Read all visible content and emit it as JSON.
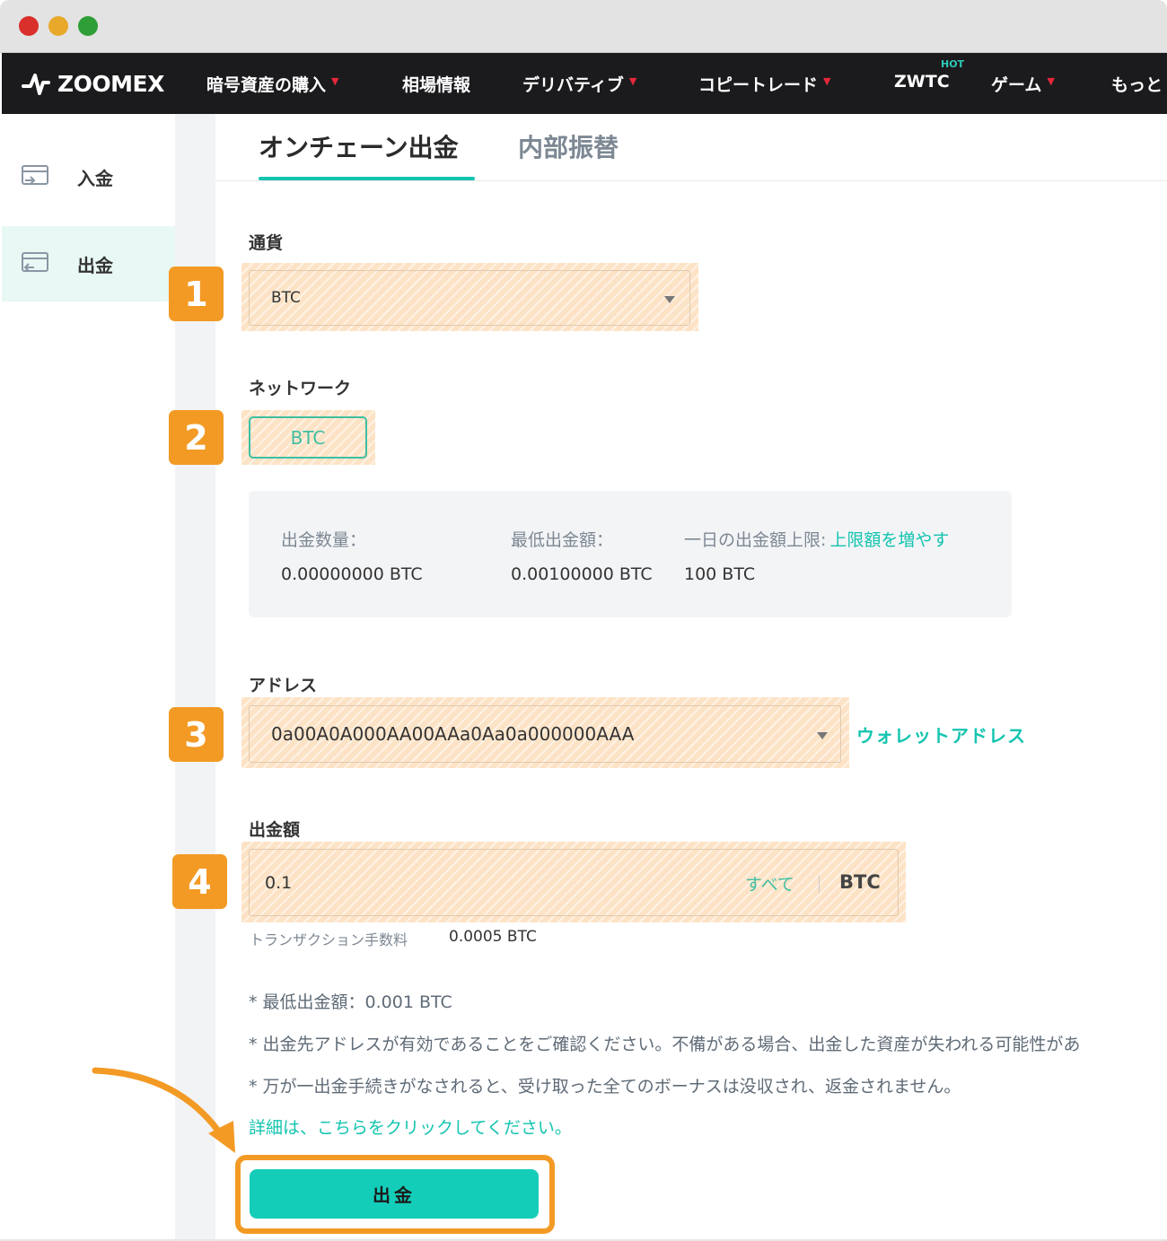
{
  "nav": {
    "brand": "ZOOMEX",
    "items": [
      {
        "label": "暗号資産の購入",
        "caret": "▼"
      },
      {
        "label": "相場情報",
        "caret": ""
      },
      {
        "label": "デリバティブ",
        "caret": "▼"
      },
      {
        "label": "コピートレード",
        "caret": "▼"
      },
      {
        "label": "ZWTC",
        "caret": ""
      },
      {
        "label": "ゲーム",
        "caret": "▼"
      },
      {
        "label": "もっと",
        "caret": ""
      }
    ],
    "hot_badge": "HOT"
  },
  "sidebar": {
    "items": [
      {
        "label": "入金",
        "icon": "deposit-icon",
        "active": false
      },
      {
        "label": "出金",
        "icon": "withdraw-icon",
        "active": true
      }
    ]
  },
  "tabs": [
    {
      "label": "オンチェーン出金",
      "active": true
    },
    {
      "label": "内部振替",
      "active": false
    }
  ],
  "form": {
    "currency_label": "通貨",
    "currency_value": "BTC",
    "network_label": "ネットワーク",
    "network_value": "BTC",
    "info": {
      "available_label": "出金数量：",
      "available_value": "0.00000000 BTC",
      "min_label": "最低出金額：",
      "min_value": "0.00100000 BTC",
      "daily_label": "一日の出金額上限:",
      "daily_link": "上限額を増やす",
      "daily_value": "100 BTC"
    },
    "address_label": "アドレス",
    "address_value": "0a00A0A000AA00AAa0Aa0a000000AAA",
    "wallet_link": "ウォレットアドレス",
    "amount_label": "出金額",
    "amount_value": "0.1",
    "amount_all": "すべて",
    "amount_unit": "BTC",
    "fee_label": "トランザクション手数料",
    "fee_value": "0.0005 BTC"
  },
  "notes": [
    "* 最低出金額：0.001 BTC",
    "* 出金先アドレスが有効であることをご確認ください。不備がある場合、出金した資産が失われる可能性があ",
    "* 万が一出金手続きがなされると、受け取った全てのボーナスは没収され、返金されません。"
  ],
  "detail_link": "詳細は、こちらをクリックしてください。",
  "submit_label": "出金",
  "step_badges": [
    "1",
    "2",
    "3",
    "4"
  ],
  "colors": {
    "accent": "#14c4b0",
    "highlight": "#fde3c6",
    "badge": "#f39a25",
    "nav_bg": "#1b1b1d",
    "caret": "#e8273a"
  }
}
